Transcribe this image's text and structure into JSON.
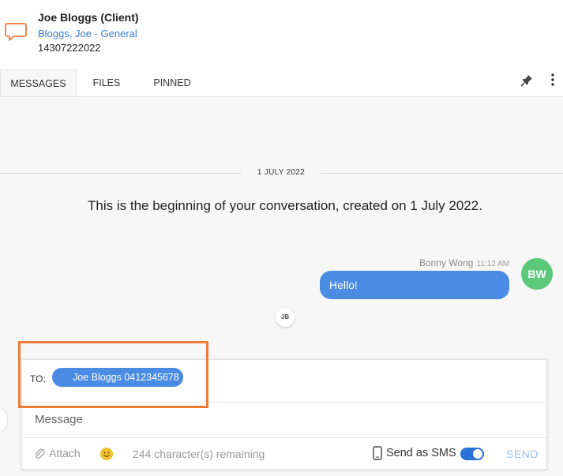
{
  "header": {
    "title": "Joe Bloggs (Client)",
    "subtitle": "Bloggs, Joe - General",
    "phone": "14307222022",
    "icon": "chat-bubble-icon",
    "icon_color": "#ef7b3a"
  },
  "tabs": [
    {
      "label": "MESSAGES",
      "active": true
    },
    {
      "label": "FILES",
      "active": false
    },
    {
      "label": "PINNED",
      "active": false
    }
  ],
  "thread": {
    "date_divider": "1 JULY 2022",
    "beginning_text": "This is the beginning of your conversation, created on 1 July 2022.",
    "messages": [
      {
        "sender": "Bonny Wong",
        "time": "11:12 AM",
        "text": "Hello!",
        "avatar_initials": "BW",
        "avatar_color": "#5bc87a",
        "bubble_color": "#4a8be3"
      }
    ],
    "typing_avatar": "JB"
  },
  "composer": {
    "to_label": "TO:",
    "recipient_chip": "Joe Bloggs 0412345678",
    "message_placeholder": "Message",
    "attach_label": "Attach",
    "char_remaining": "244 character(s) remaining",
    "send_as_sms_label": "Send as SMS",
    "send_as_sms_enabled": true,
    "send_label": "SEND"
  },
  "colors": {
    "accent": "#4a8be3",
    "highlight": "#ef7b3a",
    "toggle_on": "#2a72d8"
  }
}
